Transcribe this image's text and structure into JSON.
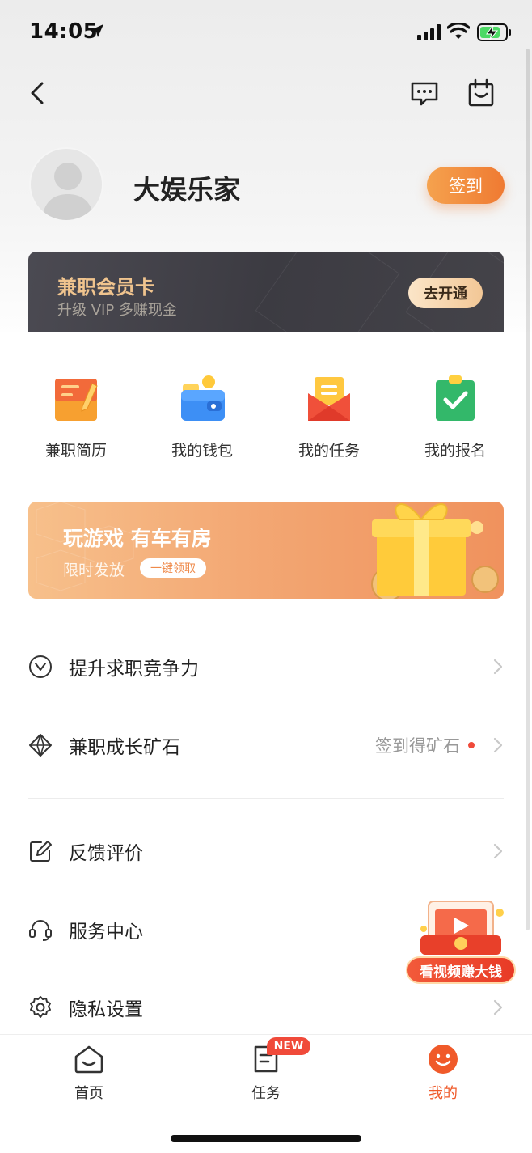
{
  "status_bar": {
    "time": "14:05"
  },
  "profile": {
    "username": "大娱乐家",
    "signin_label": "签到"
  },
  "vip_card": {
    "title": "兼职会员卡",
    "subtitle": "升级 VIP 多赚现金",
    "button_label": "去开通"
  },
  "quick_actions": [
    {
      "label": "兼职简历",
      "icon": "resume-icon"
    },
    {
      "label": "我的钱包",
      "icon": "wallet-icon"
    },
    {
      "label": "我的任务",
      "icon": "task-envelope-icon"
    },
    {
      "label": "我的报名",
      "icon": "signup-check-icon"
    }
  ],
  "banner": {
    "title": "玩游戏 有车有房",
    "subtitle": "限时发放",
    "button_label": "一键领取"
  },
  "menu": [
    {
      "label": "提升求职竞争力",
      "icon": "vip-down-icon"
    },
    {
      "label": "兼职成长矿石",
      "icon": "diamond-icon",
      "hint": "签到得矿石"
    },
    {
      "label": "反馈评价",
      "icon": "edit-icon"
    },
    {
      "label": "服务中心",
      "icon": "headset-icon"
    },
    {
      "label": "隐私设置",
      "icon": "gear-icon"
    }
  ],
  "float_ad": {
    "label": "看视频赚大钱"
  },
  "tab_bar": {
    "tabs": [
      {
        "label": "首页",
        "icon": "home-icon"
      },
      {
        "label": "任务",
        "icon": "task-icon",
        "badge": "NEW"
      },
      {
        "label": "我的",
        "icon": "smile-icon",
        "active": true
      }
    ]
  },
  "colors": {
    "accent": "#ef7a32",
    "active_tab": "#ef5a2a",
    "badge": "#f04a3a",
    "vip_gold": "#f0c48e"
  }
}
